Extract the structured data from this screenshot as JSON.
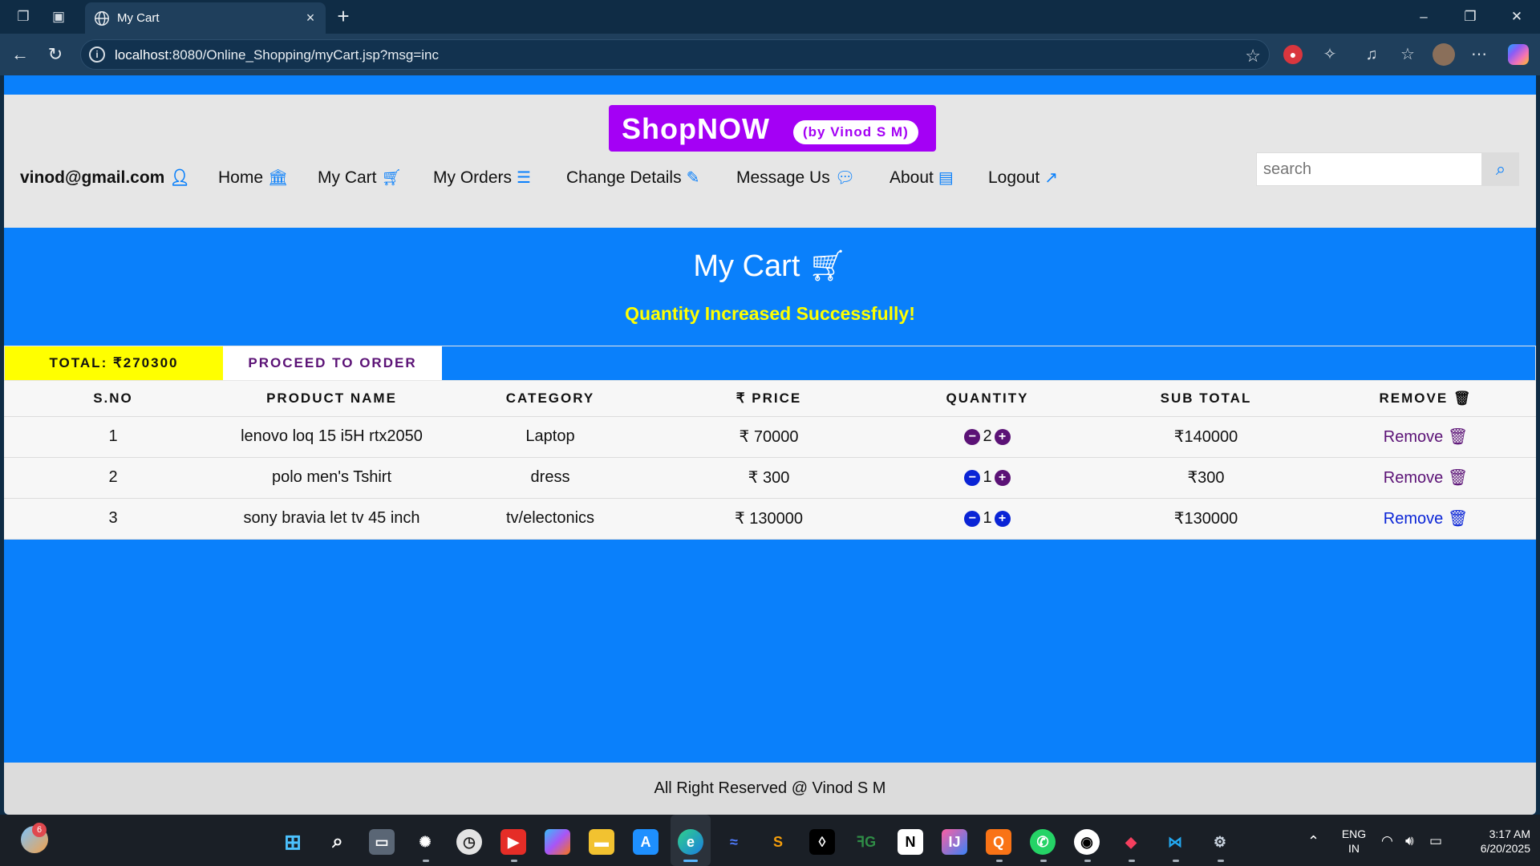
{
  "browser": {
    "tab_title": "My Cart",
    "url_host": "localhost",
    "url_rest": ":8080/Online_Shopping/myCart.jsp?msg=inc"
  },
  "header": {
    "logo_main": "ShopNOW",
    "logo_sub": "(by Vinod S M)",
    "menu": {
      "user": "vinod@gmail.com",
      "home": "Home",
      "my_cart": "My Cart",
      "my_orders": "My Orders",
      "change_details": "Change Details",
      "message_us": "Message Us",
      "about": "About",
      "logout": "Logout"
    },
    "search_placeholder": "search"
  },
  "cart": {
    "title": "My Cart",
    "message": "Quantity Increased Successfully!",
    "total_label": "TOTAL: ₹270300",
    "proceed_label": "PROCEED TO ORDER",
    "columns": [
      "S.NO",
      "PRODUCT NAME",
      "CATEGORY",
      "₹ PRICE",
      "QUANTITY",
      "SUB TOTAL",
      "REMOVE"
    ],
    "rows": [
      {
        "sno": "1",
        "name": "lenovo loq 15 i5H rtx2050",
        "category": "Laptop",
        "price": "₹ 70000",
        "qty": "2",
        "subtotal": "₹140000",
        "remove": "Remove"
      },
      {
        "sno": "2",
        "name": "polo men's Tshirt",
        "category": "dress",
        "price": "₹ 300",
        "qty": "1",
        "subtotal": "₹300",
        "remove": "Remove"
      },
      {
        "sno": "3",
        "name": "sony bravia let tv 45 inch",
        "category": "tv/electonics",
        "price": "₹ 130000",
        "qty": "1",
        "subtotal": "₹130000",
        "remove": "Remove"
      }
    ]
  },
  "footer": {
    "text": "All Right Reserved @ Vinod S M"
  },
  "taskbar": {
    "weather_badge": "6",
    "lang_1": "ENG",
    "lang_2": "IN",
    "time": "3:17 AM",
    "date": "6/20/2025"
  },
  "colors": {
    "page_blue": "#0a80fb",
    "brand_purple": "#a400f5",
    "total_yellow": "#ffff00",
    "message_yellow": "#ffff00"
  }
}
